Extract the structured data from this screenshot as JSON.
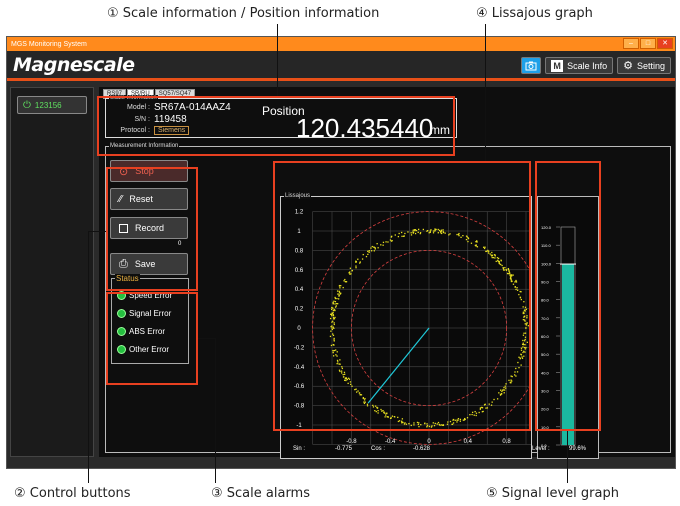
{
  "callouts": {
    "c1": "① Scale information / Position information",
    "c2": "② Control buttons",
    "c3": "③ Scale alarms",
    "c4": "④ Lissajous graph",
    "c5": "⑤ Signal level graph"
  },
  "window": {
    "title": "MGS Monitoring System",
    "min": "–",
    "max": "□",
    "close": "✕"
  },
  "header": {
    "logo": "Magnescale",
    "scale_info_label": "Scale Info",
    "setting_label": "Setting"
  },
  "sidebar": {
    "device_id": "123156"
  },
  "tabs": [
    "RS97",
    "SR/RU",
    "SQ57/SQ47"
  ],
  "scale_info": {
    "section_label": "Scale Information",
    "model_key": "Model :",
    "model": "SR67A-014AAZ4",
    "sn_key": "S/N :",
    "sn": "119458",
    "protocol_key": "Protocol :",
    "protocol": "Siemens",
    "position_label": "Position",
    "position_value": "120.435440",
    "position_unit": "mm"
  },
  "measurement": {
    "section_label": "Measurement Information"
  },
  "controls": {
    "stop": "Stop",
    "reset": "Reset",
    "record": "Record",
    "record_count": "0",
    "save": "Save"
  },
  "status": {
    "title": "Status",
    "items": [
      "Speed Error",
      "Signal Error",
      "ABS Error",
      "Other Error"
    ],
    "color": "#25c040"
  },
  "lissajous": {
    "title": "Lissajous",
    "y_ticks": [
      "1.2",
      "1",
      "0.8",
      "0.6",
      "0.4",
      "0.2",
      "0",
      "-0.2",
      "-0.4",
      "-0.6",
      "-0.8",
      "-1"
    ],
    "x_ticks": [
      "-0.8",
      "-0.4",
      "0",
      "0.4",
      "0.8"
    ],
    "sin_label": "Sin :",
    "sin_value": "-0.775",
    "cos_label": "Cos :",
    "cos_value": "-0.628"
  },
  "level": {
    "ticks": [
      "120.0",
      "110.0",
      "100.0",
      "90.0",
      "80.0",
      "70.0",
      "60.0",
      "50.0",
      "40.0",
      "30.0",
      "20.0",
      "10.0",
      "0.0"
    ],
    "level_label": "Level :",
    "level_value": "99.6%",
    "level_fraction": 0.996
  },
  "chart_data": {
    "type": "scatter",
    "title": "Lissajous",
    "xlabel": "Sin",
    "ylabel": "",
    "xlim": [
      -1.2,
      1.2
    ],
    "ylim": [
      -1.2,
      1.2
    ],
    "reference_circles": [
      1.2,
      0.8
    ],
    "series": [
      {
        "name": "Lissajous",
        "radius": 1.0,
        "color": "#e8e020"
      }
    ],
    "vector": {
      "sin": -0.775,
      "cos": -0.628
    }
  }
}
